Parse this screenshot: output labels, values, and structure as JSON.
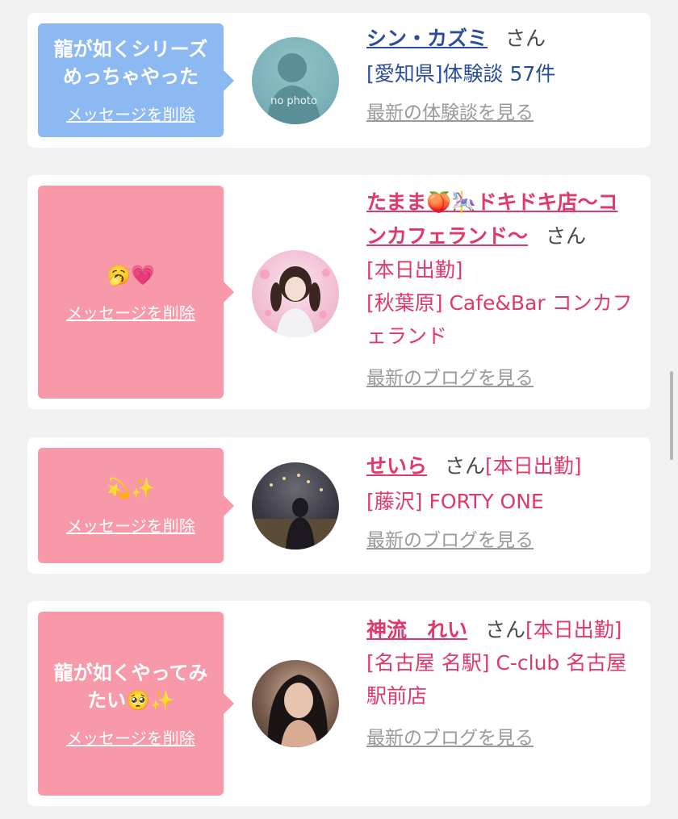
{
  "cards": [
    {
      "message": "龍が如くシリーズめっちゃやった",
      "delete_label": "メッセージを削除",
      "name": "シン・カズミ",
      "san": "さん",
      "lines": [
        "[愛知県]体験談 57件"
      ],
      "latest_link": "最新の体験談を見る",
      "avatar_text": "no photo"
    },
    {
      "message": "🥱💗",
      "delete_label": "メッセージを削除",
      "name": "たまま🍑🎠ドキドキ店〜コンカフェランド〜",
      "san": "さん",
      "lines": [
        "[本日出勤]",
        "[秋葉原] Cafe&Bar コンカフェランド"
      ],
      "latest_link": "最新のブログを見る"
    },
    {
      "message": "💫✨",
      "delete_label": "メッセージを削除",
      "name": "せいら",
      "san": "さん",
      "status": "[本日出勤]",
      "lines": [
        "[藤沢] FORTY ONE"
      ],
      "latest_link": "最新のブログを見る"
    },
    {
      "message": "龍が如くやってみたい🥺✨",
      "delete_label": "メッセージを削除",
      "name": "神流　れい",
      "san": "さん",
      "status": "[本日出勤]",
      "lines": [
        "[名古屋 名駅] C-club 名古屋駅前店"
      ],
      "latest_link": "最新のブログを見る"
    }
  ],
  "colors": {
    "background": "#f1f1f1",
    "bubble_blue": "#8cb9f2",
    "bubble_pink": "#f799a8",
    "text_blue": "#2a4e9c",
    "text_pink": "#e0386a",
    "link_gray": "#9a9a9a"
  }
}
